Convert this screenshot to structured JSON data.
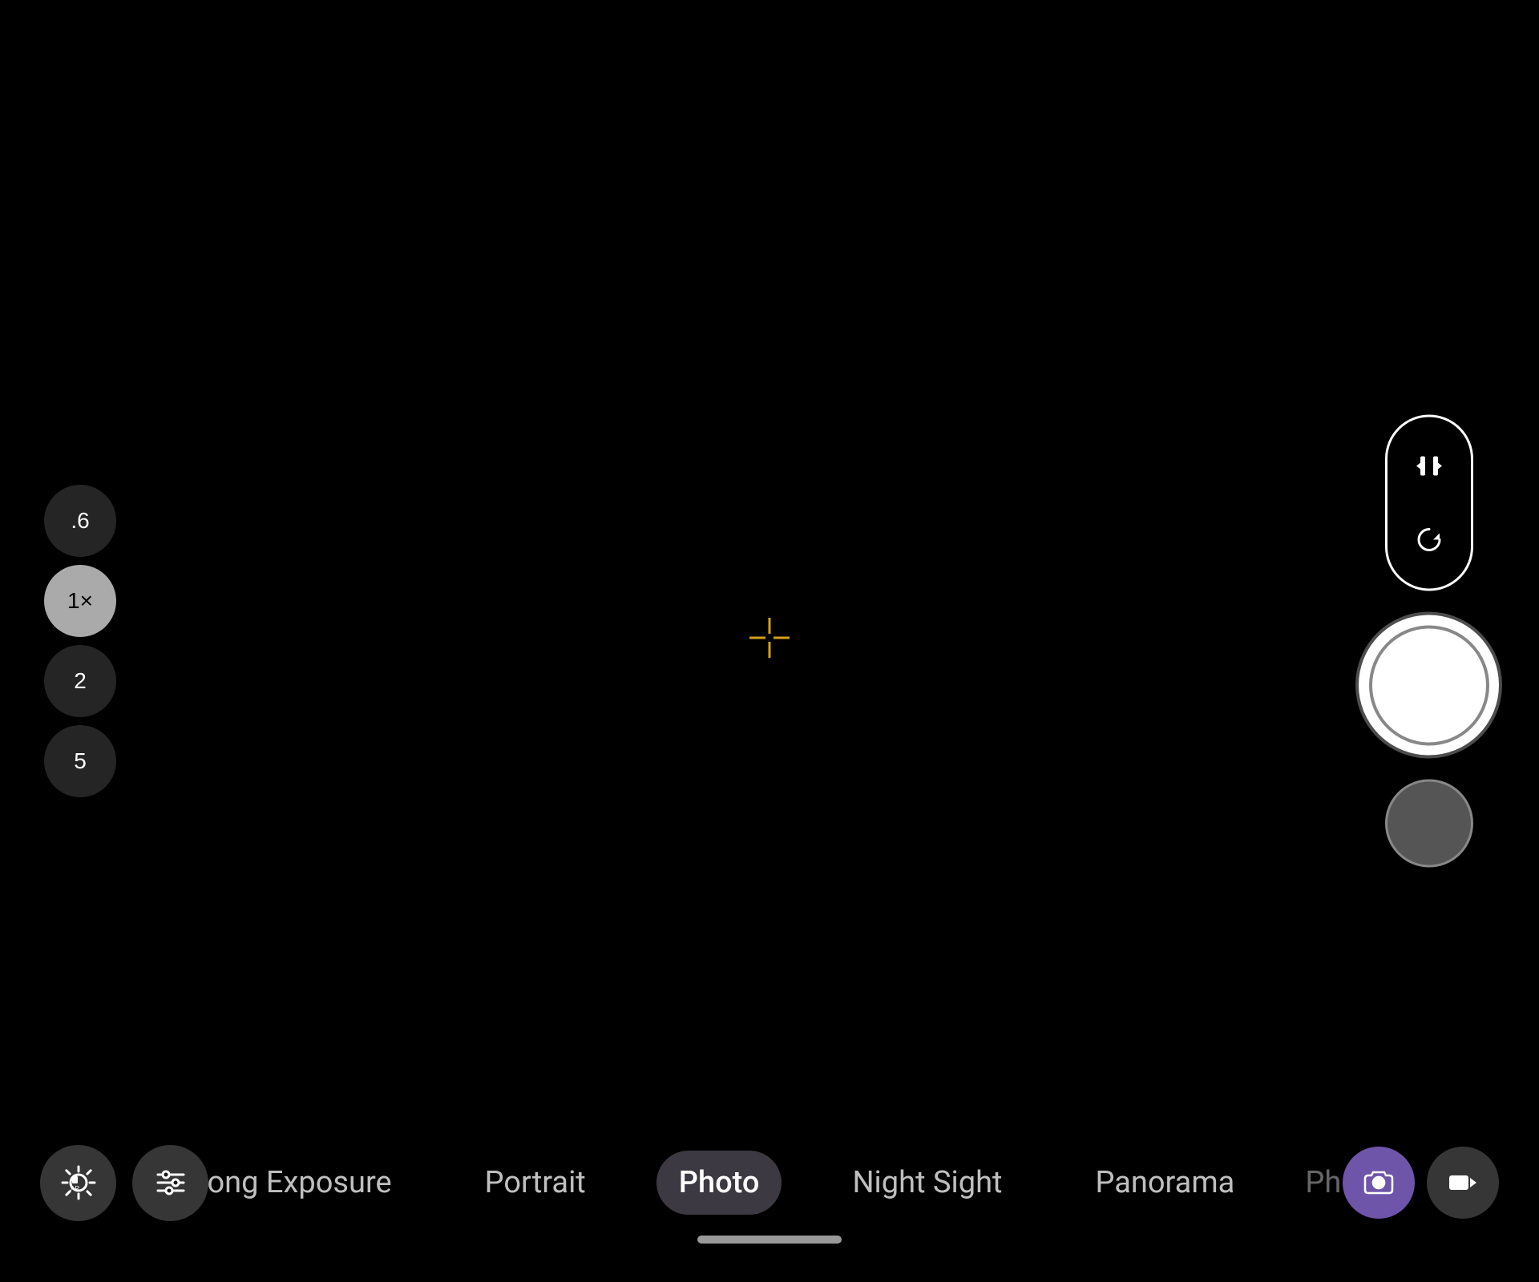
{
  "viewfinder": {
    "background": "#000000"
  },
  "crosshair": {
    "symbol": "✛",
    "color": "#d4a017"
  },
  "zoom": {
    "levels": [
      {
        "value": ".6",
        "active": false
      },
      {
        "value": "1×",
        "active": true
      },
      {
        "value": "2",
        "active": false
      },
      {
        "value": "5",
        "active": false
      }
    ]
  },
  "right_controls": {
    "flip_icon": "⇄",
    "rotate_icon": "↻",
    "shutter_label": "Shutter"
  },
  "bottom_bar": {
    "settings_icon": "⚙",
    "sliders_icon": "≡",
    "modes": [
      {
        "label": "Long Exposure",
        "active": false
      },
      {
        "label": "Portrait",
        "active": false
      },
      {
        "label": "Photo",
        "active": true
      },
      {
        "label": "Night Sight",
        "active": false
      },
      {
        "label": "Panorama",
        "active": false
      },
      {
        "label": "Pho...",
        "active": false,
        "faded": true
      }
    ],
    "photo_icon": "📷",
    "video_icon": "▶"
  }
}
